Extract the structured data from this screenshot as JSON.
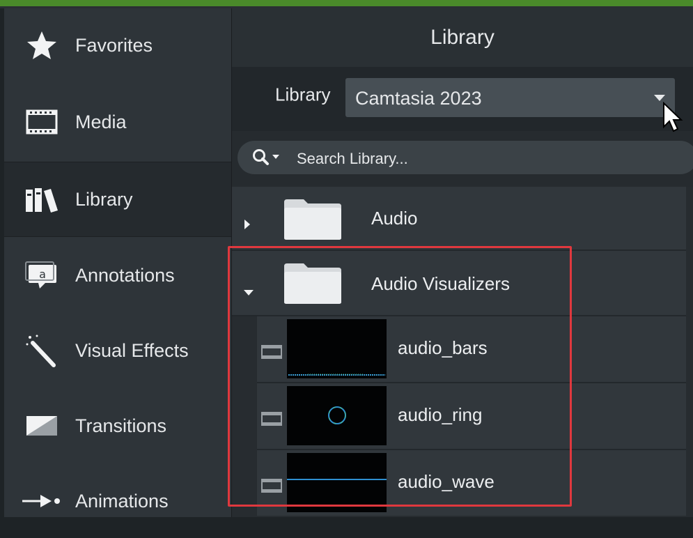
{
  "sidebar": {
    "items": [
      {
        "label": "Favorites",
        "icon": "star-icon"
      },
      {
        "label": "Media",
        "icon": "film-icon"
      },
      {
        "label": "Library",
        "icon": "books-icon",
        "active": true
      },
      {
        "label": "Annotations",
        "icon": "callout-icon"
      },
      {
        "label": "Visual Effects",
        "icon": "magic-wand-icon"
      },
      {
        "label": "Transitions",
        "icon": "transition-icon"
      },
      {
        "label": "Animations",
        "icon": "animation-arrow-icon"
      }
    ]
  },
  "panel": {
    "title": "Library",
    "library_label": "Library",
    "library_value": "Camtasia 2023",
    "search_placeholder": "Search Library..."
  },
  "tree": {
    "folders": [
      {
        "name": "Audio",
        "expanded": false
      },
      {
        "name": "Audio Visualizers",
        "expanded": true
      }
    ],
    "items": [
      {
        "name": "audio_bars"
      },
      {
        "name": "audio_ring"
      },
      {
        "name": "audio_wave"
      }
    ]
  },
  "colors": {
    "accent_border": "#e0383e",
    "top_strip": "#4a8a2a"
  }
}
